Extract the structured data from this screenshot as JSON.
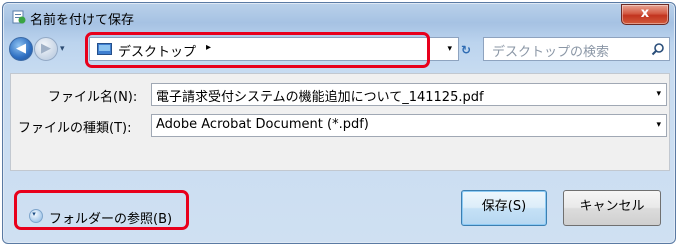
{
  "window": {
    "title": "名前を付けて保存",
    "close_label": "x"
  },
  "nav": {
    "back_glyph": "◀",
    "forward_glyph": "▶",
    "recent_glyph": "▾",
    "address_location": "デスクトップ",
    "crumb_arrow": "▸",
    "address_dropdown": "▾",
    "refresh_glyph": "↻",
    "search_placeholder": "デスクトップの検索"
  },
  "form": {
    "filename_label": "ファイル名(N):",
    "filename_value": "電子請求受付システムの機能追加について_141125.pdf",
    "filetype_label": "ファイルの種類(T):",
    "filetype_value": "Adobe Acrobat Document (*.pdf)",
    "dropdown_glyph": "▾"
  },
  "footer": {
    "browse_folders_label": "フォルダーの参照(B)",
    "browse_chevron": "▾",
    "save_label": "保存(S)",
    "cancel_label": "キャンセル"
  },
  "colors": {
    "highlight": "#e8001c",
    "window_frame": "#b9d1ea",
    "close_button": "#c2341f"
  },
  "icons": {
    "title": "save-document-icon",
    "address_folder": "desktop-folder-icon",
    "search": "search-icon",
    "browse": "expand-chevron-icon"
  }
}
